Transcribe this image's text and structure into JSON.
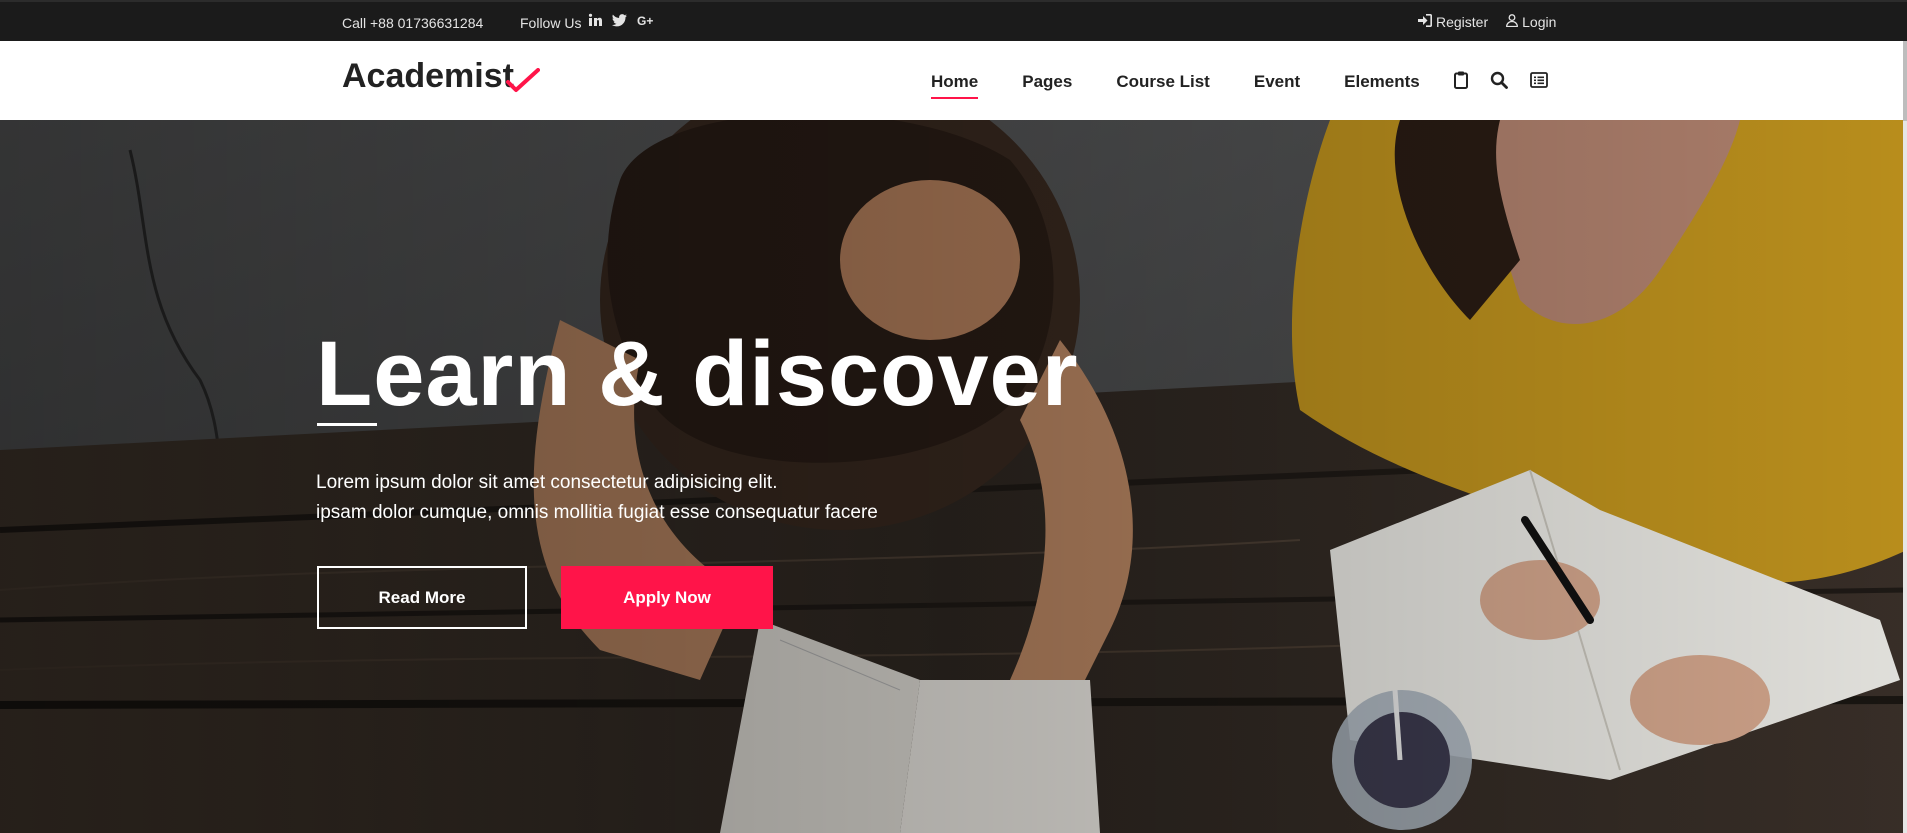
{
  "topbar": {
    "phone": "Call +88 01736631284",
    "follow_label": "Follow Us",
    "social_icons": [
      "linkedin-icon",
      "twitter-icon",
      "google-plus-icon"
    ],
    "register_label": "Register",
    "login_label": "Login"
  },
  "header": {
    "logo": "Academist",
    "nav": [
      {
        "label": "Home",
        "active": true
      },
      {
        "label": "Pages",
        "active": false
      },
      {
        "label": "Course List",
        "active": false
      },
      {
        "label": "Event",
        "active": false
      },
      {
        "label": "Elements",
        "active": false
      }
    ],
    "icons": [
      "clipboard-icon",
      "search-icon",
      "menu-list-icon"
    ]
  },
  "hero": {
    "title": "Learn & discover",
    "subtitle_line1": "Lorem ipsum dolor sit amet consectetur adipisicing elit.",
    "subtitle_line2": "ipsam dolor cumque, omnis mollitia fugiat esse consequatur facere",
    "read_more_label": "Read More",
    "apply_label": "Apply Now"
  },
  "colors": {
    "accent": "#ff1449",
    "topbar_bg": "#1b1b1b",
    "text_dark": "#222222"
  }
}
